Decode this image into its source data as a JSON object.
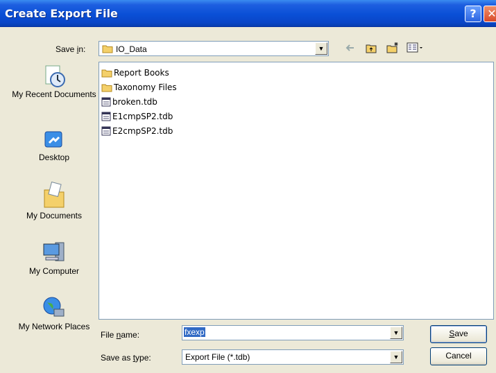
{
  "window": {
    "title": "Create Export File"
  },
  "save_in": {
    "label_pre": "Save ",
    "label_key": "i",
    "label_post": "n:",
    "value": "IO_Data"
  },
  "places": [
    {
      "label": "My Recent Documents",
      "icon": "recent-documents-icon"
    },
    {
      "label": "Desktop",
      "icon": "desktop-icon"
    },
    {
      "label": "My Documents",
      "icon": "my-documents-icon"
    },
    {
      "label": "My Computer",
      "icon": "my-computer-icon"
    },
    {
      "label": "My Network Places",
      "icon": "network-places-icon"
    }
  ],
  "files": [
    {
      "name": "Report Books",
      "type": "folder"
    },
    {
      "name": "Taxonomy Files",
      "type": "folder"
    },
    {
      "name": "broken.tdb",
      "type": "file"
    },
    {
      "name": "E1cmpSP2.tdb",
      "type": "file"
    },
    {
      "name": "E2cmpSP2.tdb",
      "type": "file"
    }
  ],
  "file_name": {
    "label_pre": "File ",
    "label_key": "n",
    "label_post": "ame:",
    "value": "fxexp"
  },
  "save_as_type": {
    "label_pre": "Save as ",
    "label_key": "t",
    "label_post": "ype:",
    "value": "Export File (*.tdb)"
  },
  "buttons": {
    "save_key": "S",
    "save_rest": "ave",
    "cancel": "Cancel"
  },
  "colors": {
    "titlebar": "#0a4fd6",
    "selection": "#316ac5",
    "dialog_bg": "#ece9d8"
  }
}
